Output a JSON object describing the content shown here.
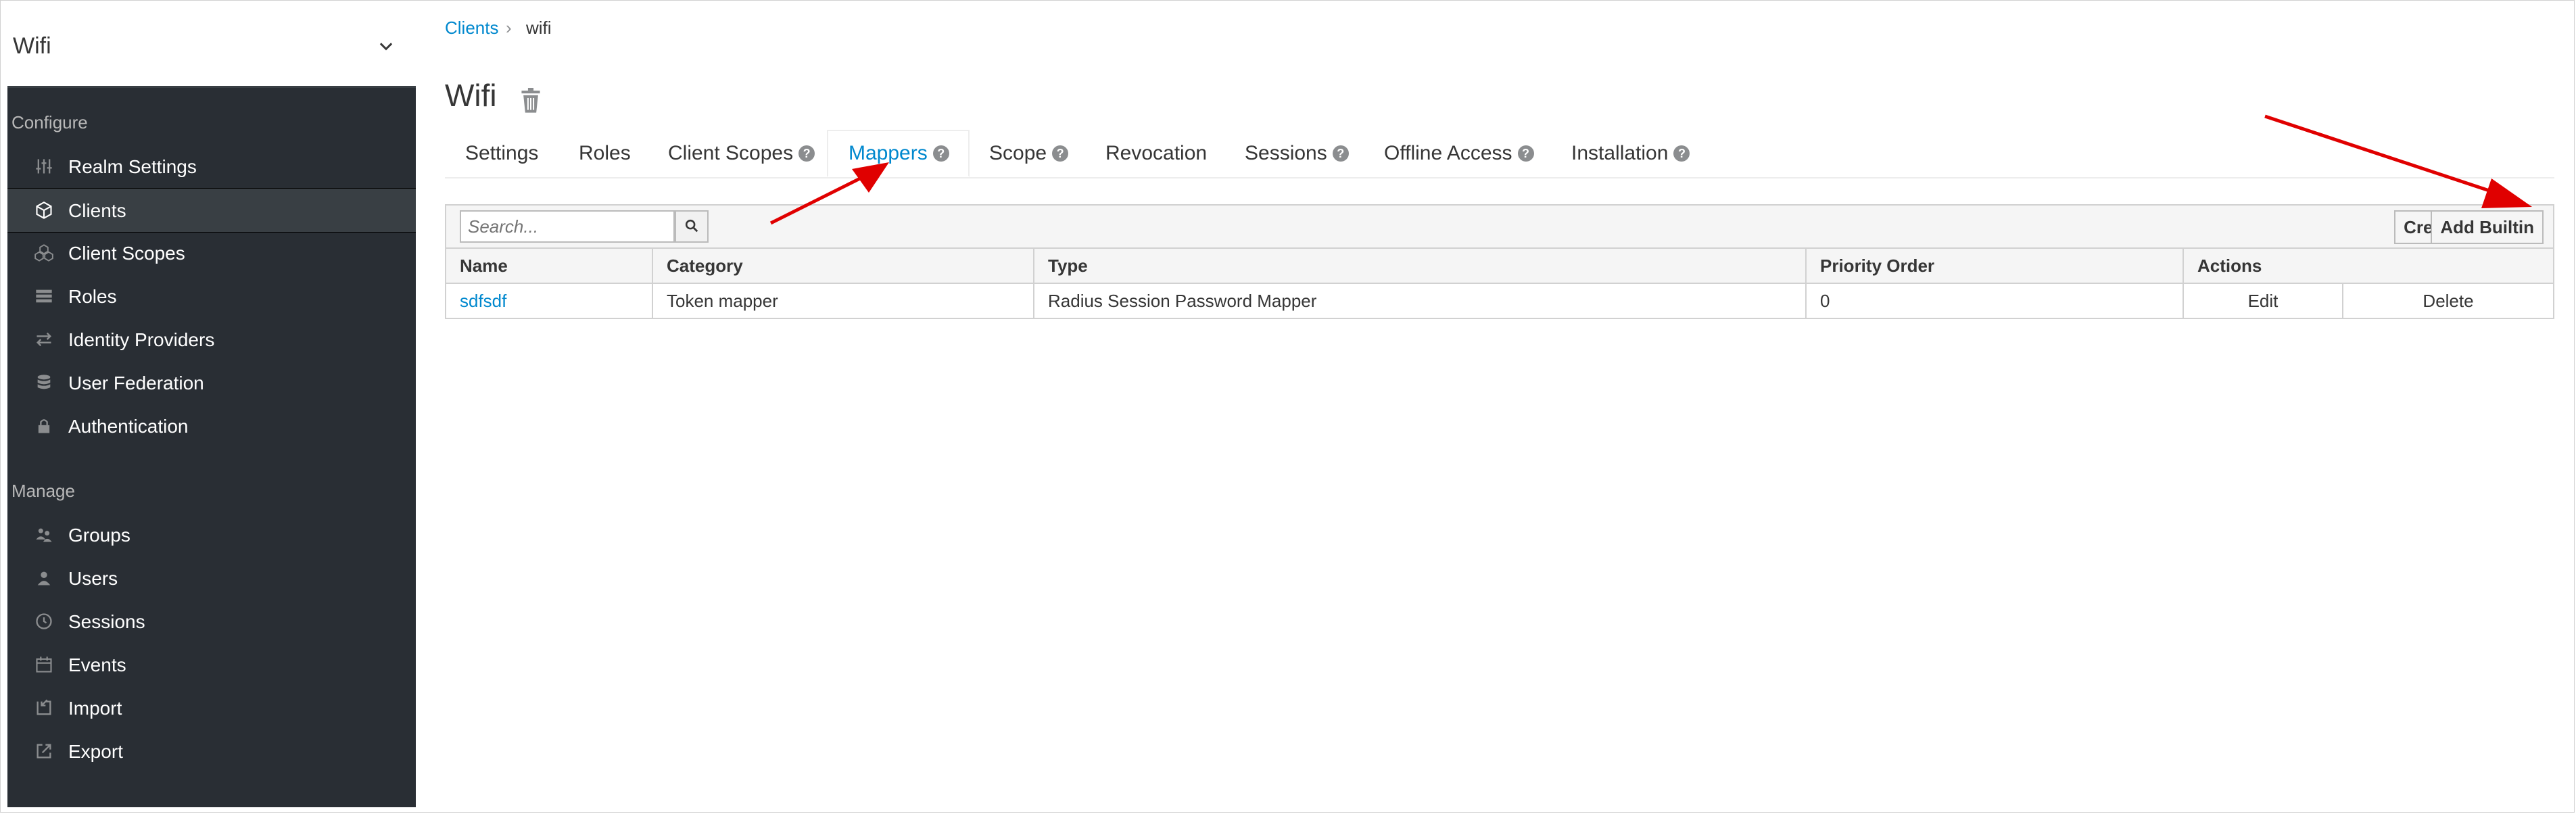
{
  "realm": {
    "name": "Wifi"
  },
  "sidebar": {
    "configure_label": "Configure",
    "manage_label": "Manage",
    "configure_items": [
      {
        "label": "Realm Settings",
        "icon": "sliders-icon"
      },
      {
        "label": "Clients",
        "icon": "cube-icon",
        "active": true
      },
      {
        "label": "Client Scopes",
        "icon": "cubes-icon"
      },
      {
        "label": "Roles",
        "icon": "list-icon"
      },
      {
        "label": "Identity Providers",
        "icon": "exchange-icon"
      },
      {
        "label": "User Federation",
        "icon": "database-icon"
      },
      {
        "label": "Authentication",
        "icon": "lock-icon"
      }
    ],
    "manage_items": [
      {
        "label": "Groups",
        "icon": "users-icon"
      },
      {
        "label": "Users",
        "icon": "user-icon"
      },
      {
        "label": "Sessions",
        "icon": "clock-icon"
      },
      {
        "label": "Events",
        "icon": "calendar-icon"
      },
      {
        "label": "Import",
        "icon": "import-icon"
      },
      {
        "label": "Export",
        "icon": "export-icon"
      }
    ]
  },
  "breadcrumb": {
    "parent": "Clients",
    "current": "wifi"
  },
  "page": {
    "title": "Wifi"
  },
  "tabs": [
    {
      "label": "Settings",
      "help": false
    },
    {
      "label": "Roles",
      "help": false
    },
    {
      "label": "Client Scopes",
      "help": true
    },
    {
      "label": "Mappers",
      "help": true,
      "active": true
    },
    {
      "label": "Scope",
      "help": true
    },
    {
      "label": "Revocation",
      "help": false
    },
    {
      "label": "Sessions",
      "help": true
    },
    {
      "label": "Offline Access",
      "help": true
    },
    {
      "label": "Installation",
      "help": true
    }
  ],
  "toolbar": {
    "search_placeholder": "Search...",
    "create_label": "Create",
    "add_builtin_label": "Add Builtin"
  },
  "table": {
    "headers": [
      "Name",
      "Category",
      "Type",
      "Priority Order",
      "Actions"
    ],
    "rows": [
      {
        "name": "sdfsdf",
        "category": "Token mapper",
        "type": "Radius Session Password Mapper",
        "priority": "0",
        "edit": "Edit",
        "delete": "Delete"
      }
    ]
  },
  "colors": {
    "sidebar_bg": "#292e34",
    "link": "#0088ce",
    "arrow": "#e00000"
  }
}
